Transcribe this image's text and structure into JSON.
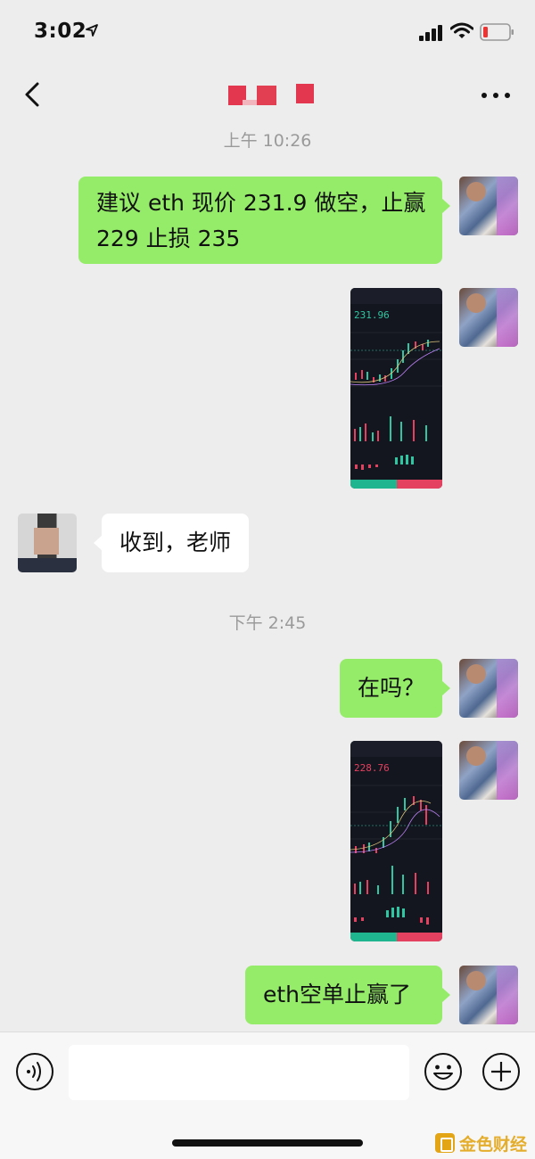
{
  "status_bar": {
    "time": "3:02",
    "icons": [
      "location-arrow-icon",
      "signal-icon",
      "wifi-icon",
      "battery-low-icon"
    ]
  },
  "nav": {
    "back_icon": "chevron-left-icon",
    "title": "",
    "more_icon": "more-dots-icon"
  },
  "messages": [
    {
      "type": "timestamp",
      "text": "上午 10:26"
    },
    {
      "type": "text",
      "sender": "me",
      "lines": [
        "建议 eth 现价 231.9 做空，止赢",
        "229 止损 235"
      ]
    },
    {
      "type": "image",
      "sender": "me",
      "content": "ETH/USDT chart screenshot",
      "price": "231.96"
    },
    {
      "type": "text",
      "sender": "other",
      "text": "收到，老师"
    },
    {
      "type": "timestamp",
      "text": "下午 2:45"
    },
    {
      "type": "text",
      "sender": "me",
      "text": "在吗？"
    },
    {
      "type": "image",
      "sender": "me",
      "content": "ETH/USDT chart screenshot",
      "price": "228.76"
    },
    {
      "type": "text",
      "sender": "me",
      "text": "eth空单止赢了"
    }
  ],
  "input_bar": {
    "voice_icon": "voice-icon",
    "input_value": "",
    "emoji_icon": "emoji-icon",
    "add_icon": "plus-circle-icon"
  },
  "watermark": {
    "text": "金色财经"
  },
  "colors": {
    "background": "#ededed",
    "my_bubble": "#95ec69",
    "other_bubble": "#ffffff",
    "timestamp": "#9a9a9a",
    "chart_up": "#2ec7a1",
    "chart_down": "#e4405f"
  }
}
